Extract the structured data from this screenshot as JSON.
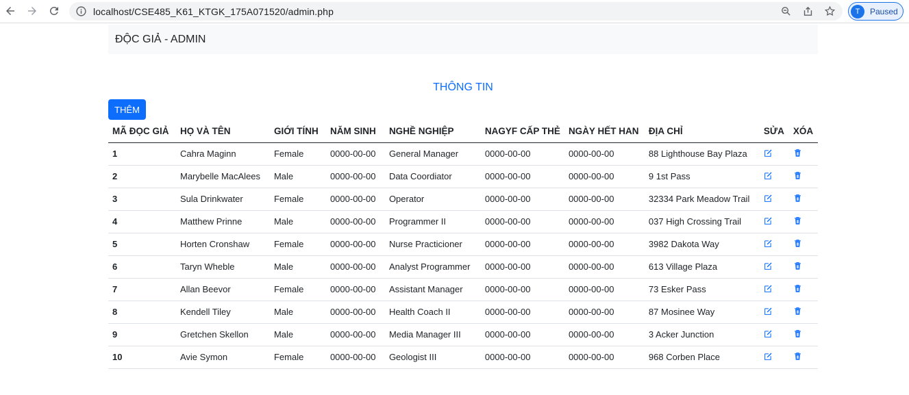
{
  "browser": {
    "url": "localhost/CSE485_K61_KTGK_175A071520/admin.php",
    "profile_initial": "T",
    "profile_status": "Paused"
  },
  "navbar": {
    "brand": "ĐỘC GIẢ - ADMIN"
  },
  "heading": "THÔNG TIN",
  "add_button": "THÊM",
  "colors": {
    "primary": "#0d6efd",
    "navbar_bg": "#f8f9fa"
  },
  "table": {
    "headers": [
      "MÃ ĐỌC GIẢ",
      "HỌ VÀ TÊN",
      "GIỚI TÍNH",
      "NĂM SINH",
      "NGHỀ NGHIỆP",
      "NAGYF CẤP THẺ",
      "NGÀY HẾT HAN",
      "ĐỊA CHỈ",
      "SỬA",
      "XÓA"
    ],
    "rows": [
      {
        "id": "1",
        "name": "Cahra Maginn",
        "gender": "Female",
        "birth": "0000-00-00",
        "job": "General Manager",
        "issued": "0000-00-00",
        "expires": "0000-00-00",
        "address": "88 Lighthouse Bay Plaza"
      },
      {
        "id": "2",
        "name": "Marybelle MacAlees",
        "gender": "Male",
        "birth": "0000-00-00",
        "job": "Data Coordiator",
        "issued": "0000-00-00",
        "expires": "0000-00-00",
        "address": "9 1st Pass"
      },
      {
        "id": "3",
        "name": "Sula Drinkwater",
        "gender": "Female",
        "birth": "0000-00-00",
        "job": "Operator",
        "issued": "0000-00-00",
        "expires": "0000-00-00",
        "address": "32334 Park Meadow Trail"
      },
      {
        "id": "4",
        "name": "Matthew Prinne",
        "gender": "Male",
        "birth": "0000-00-00",
        "job": "Programmer II",
        "issued": "0000-00-00",
        "expires": "0000-00-00",
        "address": "037 High Crossing Trail"
      },
      {
        "id": "5",
        "name": "Horten Cronshaw",
        "gender": "Female",
        "birth": "0000-00-00",
        "job": "Nurse Practicioner",
        "issued": "0000-00-00",
        "expires": "0000-00-00",
        "address": "3982 Dakota Way"
      },
      {
        "id": "6",
        "name": "Taryn Wheble",
        "gender": "Male",
        "birth": "0000-00-00",
        "job": "Analyst Programmer",
        "issued": "0000-00-00",
        "expires": "0000-00-00",
        "address": "613 Village Plaza"
      },
      {
        "id": "7",
        "name": "Allan Beevor",
        "gender": "Female",
        "birth": "0000-00-00",
        "job": "Assistant Manager",
        "issued": "0000-00-00",
        "expires": "0000-00-00",
        "address": "73 Esker Pass"
      },
      {
        "id": "8",
        "name": "Kendell Tiley",
        "gender": "Male",
        "birth": "0000-00-00",
        "job": "Health Coach II",
        "issued": "0000-00-00",
        "expires": "0000-00-00",
        "address": "87 Mosinee Way"
      },
      {
        "id": "9",
        "name": "Gretchen Skellon",
        "gender": "Male",
        "birth": "0000-00-00",
        "job": "Media Manager III",
        "issued": "0000-00-00",
        "expires": "0000-00-00",
        "address": "3 Acker Junction"
      },
      {
        "id": "10",
        "name": "Avie Symon",
        "gender": "Female",
        "birth": "0000-00-00",
        "job": "Geologist III",
        "issued": "0000-00-00",
        "expires": "0000-00-00",
        "address": "968 Corben Place"
      }
    ]
  }
}
